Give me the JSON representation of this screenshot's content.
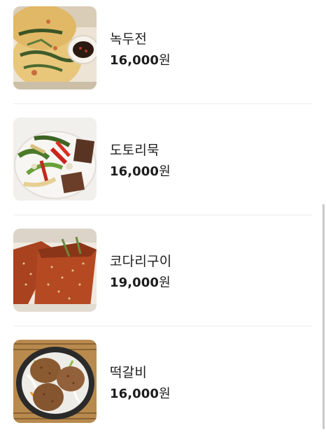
{
  "menu": {
    "items": [
      {
        "name": "녹두전",
        "price": "16,000",
        "currency": "원",
        "image_icon": "mung-bean-pancake-image"
      },
      {
        "name": "도토리묵",
        "price": "16,000",
        "currency": "원",
        "image_icon": "acorn-jelly-salad-image"
      },
      {
        "name": "코다리구이",
        "price": "19,000",
        "currency": "원",
        "image_icon": "grilled-pollock-image"
      },
      {
        "name": "떡갈비",
        "price": "16,000",
        "currency": "원",
        "image_icon": "tteokgalbi-image"
      }
    ]
  },
  "colors": {
    "text": "#1c1c1c",
    "divider": "#ececec",
    "scrollbar": "#c9c9c9",
    "background": "#ffffff"
  }
}
